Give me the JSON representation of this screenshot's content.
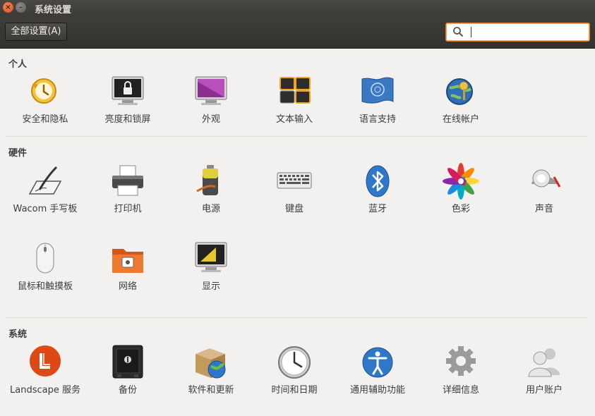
{
  "window": {
    "title": "系统设置",
    "close_glyph": "×",
    "min_glyph": "–"
  },
  "toolbar": {
    "all_settings_label": "全部设置(A)",
    "search_value": "",
    "search_placeholder": ""
  },
  "sections": {
    "personal": {
      "title": "个人",
      "items": [
        {
          "label": "安全和隐私",
          "icon": "security-privacy-icon"
        },
        {
          "label": "亮度和锁屏",
          "icon": "brightness-lock-icon"
        },
        {
          "label": "外观",
          "icon": "appearance-icon"
        },
        {
          "label": "文本输入",
          "icon": "text-entry-icon"
        },
        {
          "label": "语言支持",
          "icon": "language-support-icon"
        },
        {
          "label": "在线帐户",
          "icon": "online-accounts-icon"
        }
      ]
    },
    "hardware": {
      "title": "硬件",
      "items": [
        {
          "label": "Wacom 手写板",
          "icon": "wacom-tablet-icon"
        },
        {
          "label": "打印机",
          "icon": "printer-icon"
        },
        {
          "label": "电源",
          "icon": "power-icon"
        },
        {
          "label": "键盘",
          "icon": "keyboard-icon"
        },
        {
          "label": "蓝牙",
          "icon": "bluetooth-icon"
        },
        {
          "label": "色彩",
          "icon": "color-icon"
        },
        {
          "label": "声音",
          "icon": "sound-icon"
        },
        {
          "label": "鼠标和触摸板",
          "icon": "mouse-touchpad-icon"
        },
        {
          "label": "网络",
          "icon": "network-icon"
        },
        {
          "label": "显示",
          "icon": "display-icon"
        }
      ]
    },
    "system": {
      "title": "系统",
      "items": [
        {
          "label": "Landscape 服务",
          "icon": "landscape-icon"
        },
        {
          "label": "备份",
          "icon": "backup-icon"
        },
        {
          "label": "软件和更新",
          "icon": "software-updates-icon"
        },
        {
          "label": "时间和日期",
          "icon": "time-date-icon"
        },
        {
          "label": "通用辅助功能",
          "icon": "universal-access-icon"
        },
        {
          "label": "详细信息",
          "icon": "details-icon"
        },
        {
          "label": "用户账户",
          "icon": "user-accounts-icon"
        }
      ]
    }
  }
}
